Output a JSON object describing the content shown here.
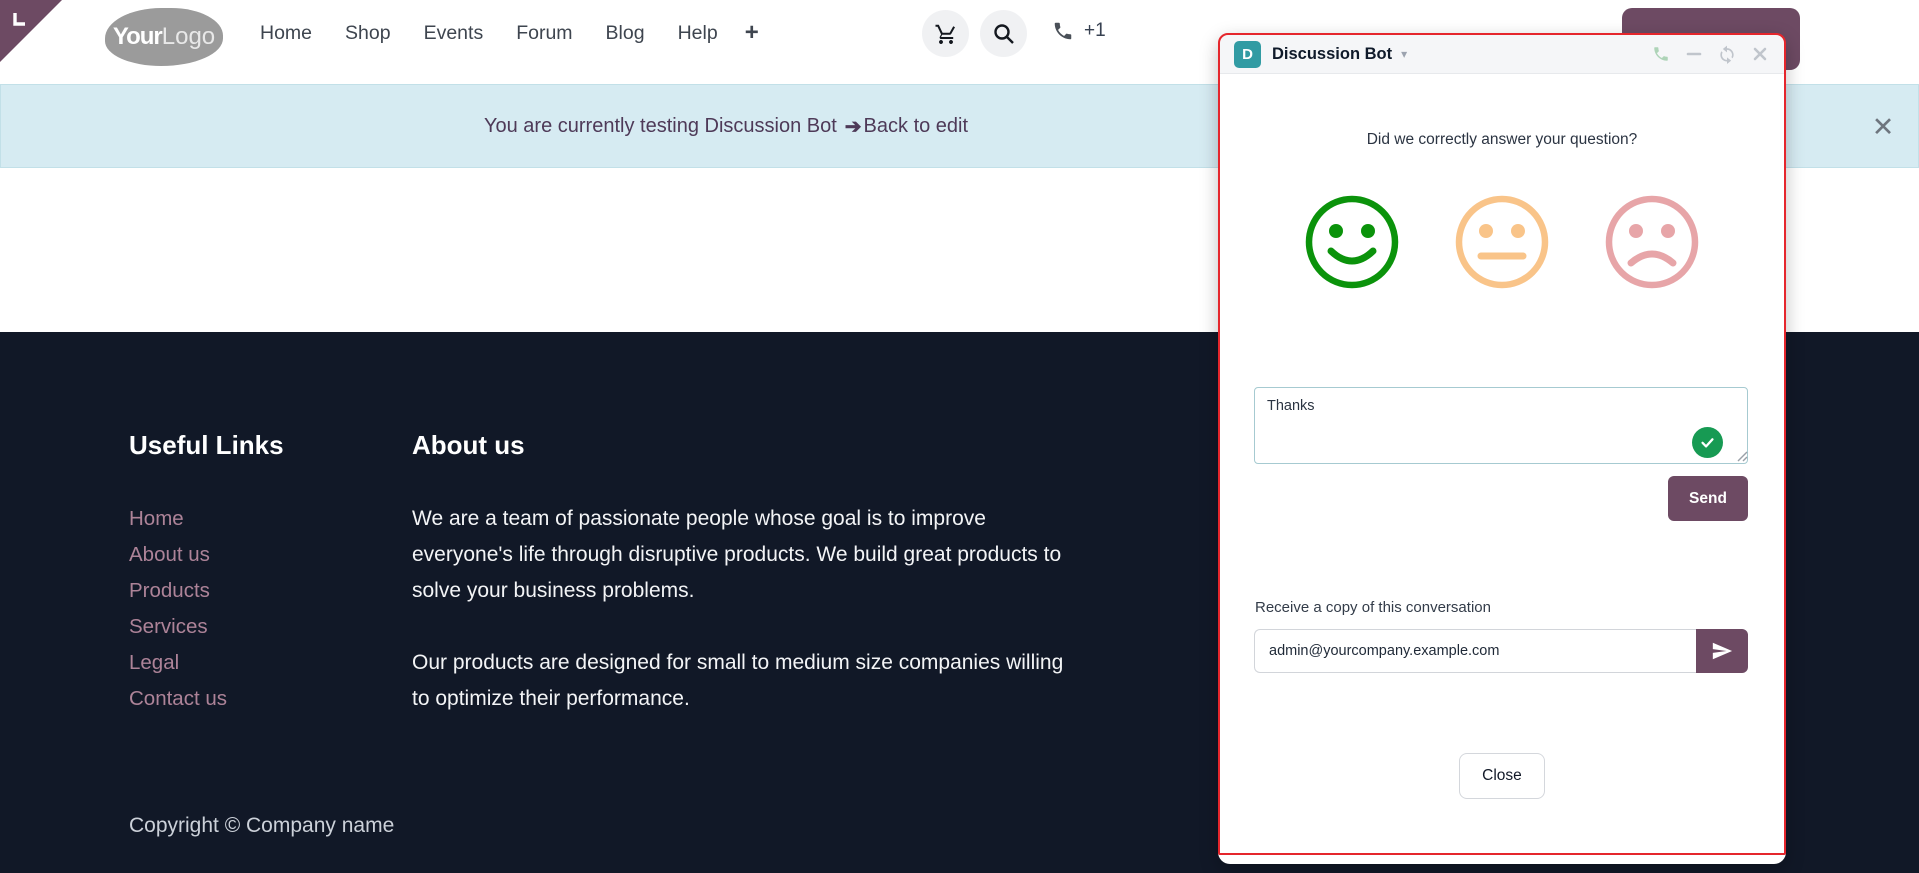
{
  "nav": {
    "logo_part1": "Your",
    "logo_part2": "Logo",
    "links": [
      "Home",
      "Shop",
      "Events",
      "Forum",
      "Blog",
      "Help"
    ],
    "plus_label": "+",
    "phone_text": "+1"
  },
  "banner": {
    "text": "You are currently testing Discussion Bot",
    "arrow": "➔",
    "link_text": "Back to edit",
    "close_icon": "✕"
  },
  "chat": {
    "avatar_letter": "D",
    "title": "Discussion Bot",
    "caret": "▾",
    "question": "Did we correctly answer your question?",
    "message_value": "Thanks",
    "send_label": "Send",
    "copy_label": "Receive a copy of this conversation",
    "email_value": "admin@yourcompany.example.com",
    "close_label": "Close"
  },
  "footer": {
    "useful_links_title": "Useful Links",
    "links": [
      "Home",
      "About us",
      "Products",
      "Services",
      "Legal",
      "Contact us"
    ],
    "about_title": "About us",
    "about_p1": "We are a team of passionate people whose goal is to improve everyone's life through disruptive products. We build great products to solve your business problems.",
    "about_p2": "Our products are designed for small to medium size companies willing to optimize their performance.",
    "copyright": "Copyright © Company name"
  },
  "colors": {
    "accent_purple": "#6d4a63",
    "banner_bg": "#d6ebf2",
    "banner_text": "#4e3a58",
    "footer_bg": "#111827",
    "footer_link": "#ad8398",
    "widget_outline_red": "#e5262c",
    "avatar_teal": "#319ba3",
    "happy_green": "#0b930b",
    "neutral_orange": "#f9c489",
    "sad_rose": "#e7a5a8",
    "check_green": "#179a53"
  }
}
